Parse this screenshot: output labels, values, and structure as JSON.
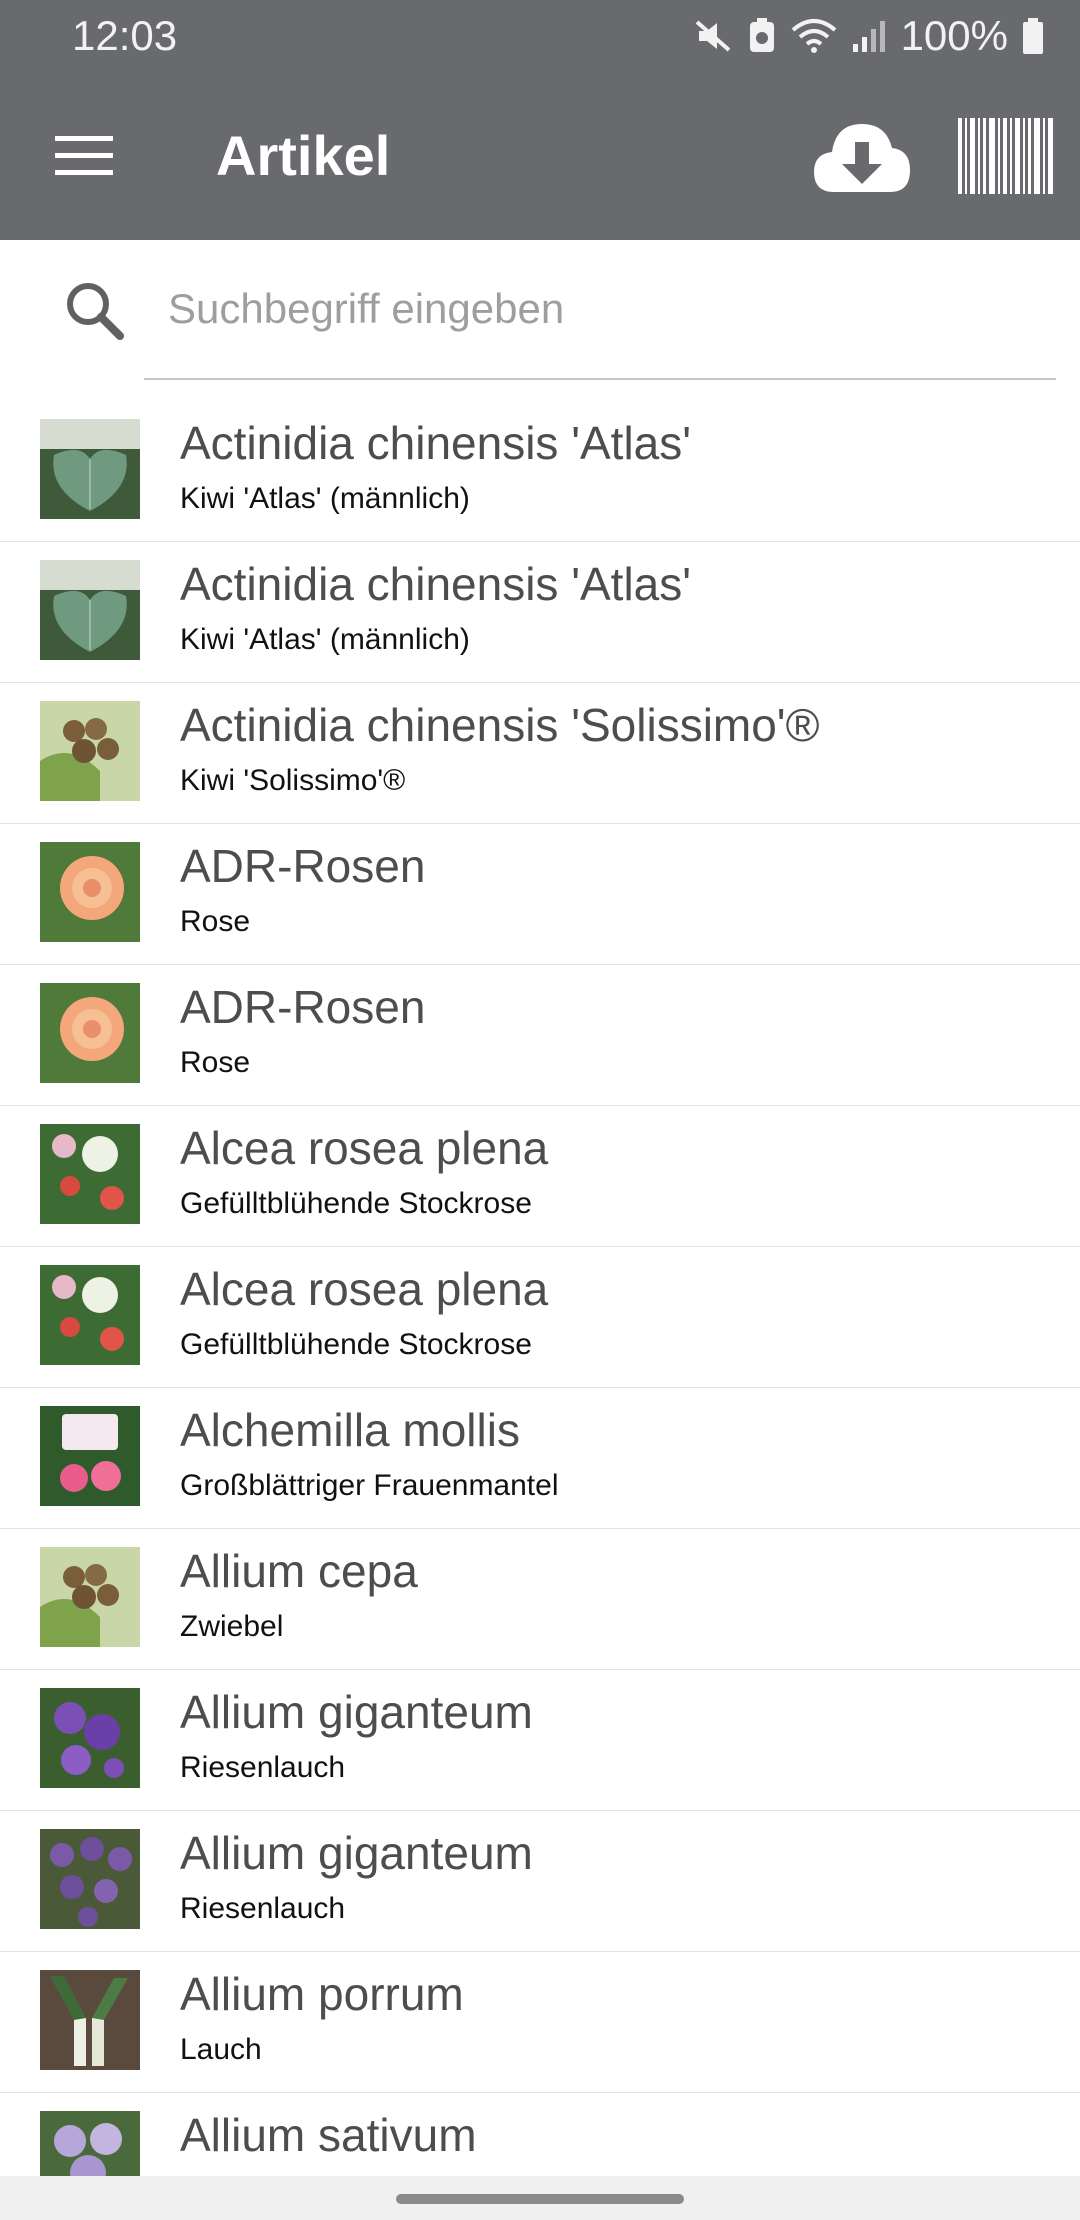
{
  "status_bar": {
    "time": "12:03",
    "battery": "100%",
    "icons": [
      "mute-icon",
      "data-saver-icon",
      "wifi-icon",
      "signal-icon",
      "battery-icon"
    ]
  },
  "app_bar": {
    "title": "Artikel",
    "icons": [
      "hamburger-menu-icon",
      "cloud-download-icon",
      "barcode-icon"
    ]
  },
  "search": {
    "placeholder": "Suchbegriff eingeben",
    "value": ""
  },
  "colors": {
    "app_bar": "#686a6d",
    "title_text": "#4d4d4d",
    "divider": "#e3e3e3"
  },
  "articles": [
    {
      "title": "Actinidia chinensis 'Atlas'",
      "subtitle": "Kiwi 'Atlas' (männlich)",
      "thumb": "kiwi-leaf-image"
    },
    {
      "title": "Actinidia chinensis 'Atlas'",
      "subtitle": "Kiwi 'Atlas' (männlich)",
      "thumb": "kiwi-leaf-image"
    },
    {
      "title": "Actinidia chinensis 'Solissimo'®",
      "subtitle": "Kiwi 'Solissimo'®",
      "thumb": "kiwi-fruit-image"
    },
    {
      "title": "ADR-Rosen",
      "subtitle": "Rose",
      "thumb": "peach-rose-image"
    },
    {
      "title": "ADR-Rosen",
      "subtitle": "Rose",
      "thumb": "peach-rose-image"
    },
    {
      "title": "Alcea rosea plena",
      "subtitle": "Gefülltblühende Stockrose",
      "thumb": "hollyhock-image"
    },
    {
      "title": "Alcea rosea plena",
      "subtitle": "Gefülltblühende Stockrose",
      "thumb": "hollyhock-image"
    },
    {
      "title": "Alchemilla mollis",
      "subtitle": "Großblättriger Frauenmantel",
      "thumb": "pink-rose-sign-image"
    },
    {
      "title": "Allium cepa",
      "subtitle": "Zwiebel",
      "thumb": "kiwi-fruit-image"
    },
    {
      "title": "Allium giganteum",
      "subtitle": "Riesenlauch",
      "thumb": "purple-flower-image"
    },
    {
      "title": "Allium giganteum",
      "subtitle": "Riesenlauch",
      "thumb": "allium-ball-image"
    },
    {
      "title": "Allium porrum",
      "subtitle": "Lauch",
      "thumb": "leek-image"
    },
    {
      "title": "Allium sativum",
      "subtitle": "",
      "thumb": "lilac-flower-image"
    }
  ]
}
